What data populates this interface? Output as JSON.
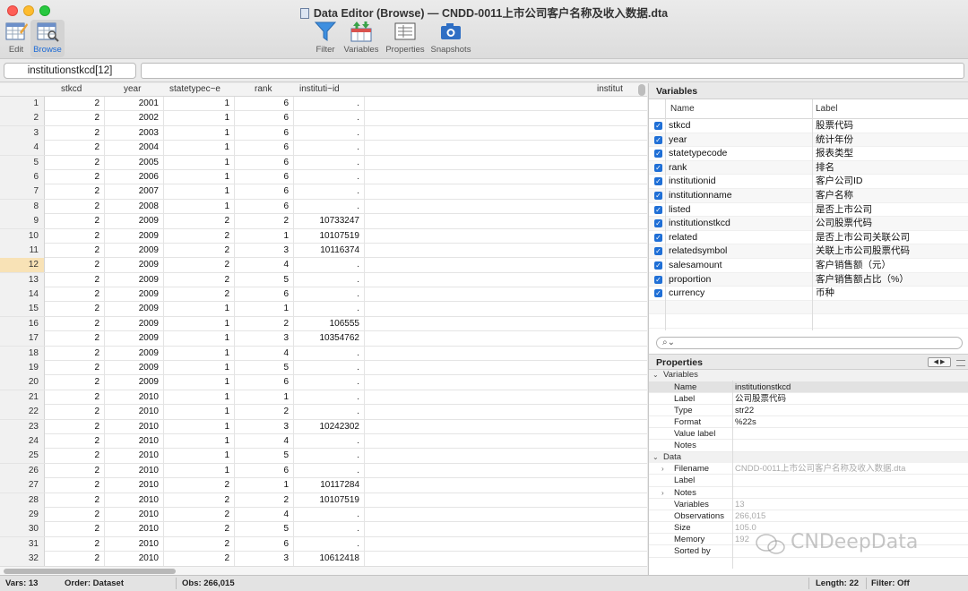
{
  "window": {
    "title": "Data Editor (Browse) — CNDD-0011上市公司客户名称及收入数据.dta"
  },
  "toolbar": {
    "edit": "Edit",
    "browse": "Browse",
    "filter": "Filter",
    "variables": "Variables",
    "properties": "Properties",
    "snapshots": "Snapshots"
  },
  "cellbar": {
    "cell_name": "institutionstkcd[12]",
    "cell_value": ""
  },
  "grid": {
    "columns": [
      "stkcd",
      "year",
      "statetypec~e",
      "rank",
      "instituti~id",
      "institut"
    ],
    "selected_row": 12,
    "rows": [
      [
        "1",
        "2",
        "2001",
        "1",
        "6",
        "."
      ],
      [
        "2",
        "2",
        "2002",
        "1",
        "6",
        "."
      ],
      [
        "3",
        "2",
        "2003",
        "1",
        "6",
        "."
      ],
      [
        "4",
        "2",
        "2004",
        "1",
        "6",
        "."
      ],
      [
        "5",
        "2",
        "2005",
        "1",
        "6",
        "."
      ],
      [
        "6",
        "2",
        "2006",
        "1",
        "6",
        "."
      ],
      [
        "7",
        "2",
        "2007",
        "1",
        "6",
        "."
      ],
      [
        "8",
        "2",
        "2008",
        "1",
        "6",
        "."
      ],
      [
        "9",
        "2",
        "2009",
        "2",
        "2",
        "10733247"
      ],
      [
        "10",
        "2",
        "2009",
        "2",
        "1",
        "10107519"
      ],
      [
        "11",
        "2",
        "2009",
        "2",
        "3",
        "10116374"
      ],
      [
        "12",
        "2",
        "2009",
        "2",
        "4",
        "."
      ],
      [
        "13",
        "2",
        "2009",
        "2",
        "5",
        "."
      ],
      [
        "14",
        "2",
        "2009",
        "2",
        "6",
        "."
      ],
      [
        "15",
        "2",
        "2009",
        "1",
        "1",
        "."
      ],
      [
        "16",
        "2",
        "2009",
        "1",
        "2",
        "106555"
      ],
      [
        "17",
        "2",
        "2009",
        "1",
        "3",
        "10354762"
      ],
      [
        "18",
        "2",
        "2009",
        "1",
        "4",
        "."
      ],
      [
        "19",
        "2",
        "2009",
        "1",
        "5",
        "."
      ],
      [
        "20",
        "2",
        "2009",
        "1",
        "6",
        "."
      ],
      [
        "21",
        "2",
        "2010",
        "1",
        "1",
        "."
      ],
      [
        "22",
        "2",
        "2010",
        "1",
        "2",
        "."
      ],
      [
        "23",
        "2",
        "2010",
        "1",
        "3",
        "10242302"
      ],
      [
        "24",
        "2",
        "2010",
        "1",
        "4",
        "."
      ],
      [
        "25",
        "2",
        "2010",
        "1",
        "5",
        "."
      ],
      [
        "26",
        "2",
        "2010",
        "1",
        "6",
        "."
      ],
      [
        "27",
        "2",
        "2010",
        "2",
        "1",
        "10117284"
      ],
      [
        "28",
        "2",
        "2010",
        "2",
        "2",
        "10107519"
      ],
      [
        "29",
        "2",
        "2010",
        "2",
        "4",
        "."
      ],
      [
        "30",
        "2",
        "2010",
        "2",
        "5",
        "."
      ],
      [
        "31",
        "2",
        "2010",
        "2",
        "6",
        "."
      ],
      [
        "32",
        "2",
        "2010",
        "2",
        "3",
        "10612418"
      ]
    ]
  },
  "variables_panel": {
    "title": "Variables",
    "col_name": "Name",
    "col_label": "Label",
    "items": [
      {
        "name": "stkcd",
        "label": "股票代码"
      },
      {
        "name": "year",
        "label": "统计年份"
      },
      {
        "name": "statetypecode",
        "label": "报表类型"
      },
      {
        "name": "rank",
        "label": "排名"
      },
      {
        "name": "institutionid",
        "label": "客户公司ID"
      },
      {
        "name": "institutionname",
        "label": "客户名称"
      },
      {
        "name": "listed",
        "label": "是否上市公司"
      },
      {
        "name": "institutionstkcd",
        "label": "公司股票代码"
      },
      {
        "name": "related",
        "label": "是否上市公司关联公司"
      },
      {
        "name": "relatedsymbol",
        "label": "关联上市公司股票代码"
      },
      {
        "name": "salesamount",
        "label": "客户销售额（元）"
      },
      {
        "name": "proportion",
        "label": "客户销售额占比（%）"
      },
      {
        "name": "currency",
        "label": "币种"
      }
    ]
  },
  "properties_panel": {
    "title": "Properties",
    "nav": "◀ ▶",
    "variables_section": "Variables",
    "var_props": [
      {
        "key": "Name",
        "value": "institutionstkcd"
      },
      {
        "key": "Label",
        "value": "公司股票代码"
      },
      {
        "key": "Type",
        "value": "str22"
      },
      {
        "key": "Format",
        "value": "%22s"
      },
      {
        "key": "Value label",
        "value": ""
      },
      {
        "key": "Notes",
        "value": ""
      }
    ],
    "data_section": "Data",
    "data_props": [
      {
        "key": "Filename",
        "value": "CNDD-0011上市公司客户名称及收入数据.dta"
      },
      {
        "key": "Label",
        "value": ""
      },
      {
        "key": "Notes",
        "value": ""
      },
      {
        "key": "Variables",
        "value": "13"
      },
      {
        "key": "Observations",
        "value": "266,015"
      },
      {
        "key": "Size",
        "value": "105.0"
      },
      {
        "key": "Memory",
        "value": "192"
      },
      {
        "key": "Sorted by",
        "value": ""
      }
    ]
  },
  "status": {
    "vars": "Vars: 13",
    "order": "Order: Dataset",
    "obs": "Obs: 266,015",
    "length": "Length: 22",
    "filter": "Filter: Off"
  },
  "watermark": "CNDeepData"
}
